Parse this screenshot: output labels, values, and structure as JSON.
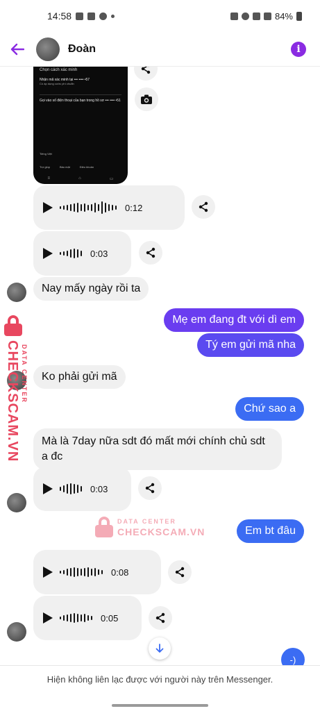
{
  "status_bar": {
    "time": "14:58",
    "battery": "84%"
  },
  "header": {
    "contact_name": "Đoàn"
  },
  "screenshot": {
    "title": "Chọn cách xác minh",
    "option1_title": "Nhận mã xác minh tại ••• •••• •57",
    "option1_sub": "Có áp dụng cước phí chuẩn",
    "option2_title": "Gọi vào số điện thoại của bạn trong hồ sơ ••• •••• •51",
    "language": "Tiếng Việt",
    "footer_links": [
      "Trợ giúp",
      "Bảo mật",
      "Điều khoản"
    ]
  },
  "messages": [
    {
      "type": "audio",
      "duration": "0:12"
    },
    {
      "type": "audio",
      "duration": "0:03"
    },
    {
      "type": "text",
      "text": "Nay mấy ngày rồi ta"
    },
    {
      "type": "text",
      "text": "Mẹ em đang đt với dì em"
    },
    {
      "type": "text",
      "text": "Tý em gửi mã nha"
    },
    {
      "type": "text",
      "text": "Ko phải gửi mã"
    },
    {
      "type": "text",
      "text": "Chứ sao a"
    },
    {
      "type": "text",
      "text": "Mà là 7day nữa sdt đó mất mới chính chủ sdt a đc"
    },
    {
      "type": "audio",
      "duration": "0:03"
    },
    {
      "type": "text",
      "text": "Em bt đâu"
    },
    {
      "type": "audio",
      "duration": "0:08"
    },
    {
      "type": "audio",
      "duration": "0:05"
    }
  ],
  "watermark": {
    "line1": "DATA CENTER",
    "line2": "CHECKSCAM.VN"
  },
  "corner_badge": "-)",
  "footer_note": "Hiện không liên lạc được với người này trên Messenger.",
  "colors": {
    "accent": "#8a2be2",
    "outgoing_purple": "#6a3df0",
    "outgoing_blue": "#3b6cf3",
    "incoming": "#f0f0f0"
  }
}
